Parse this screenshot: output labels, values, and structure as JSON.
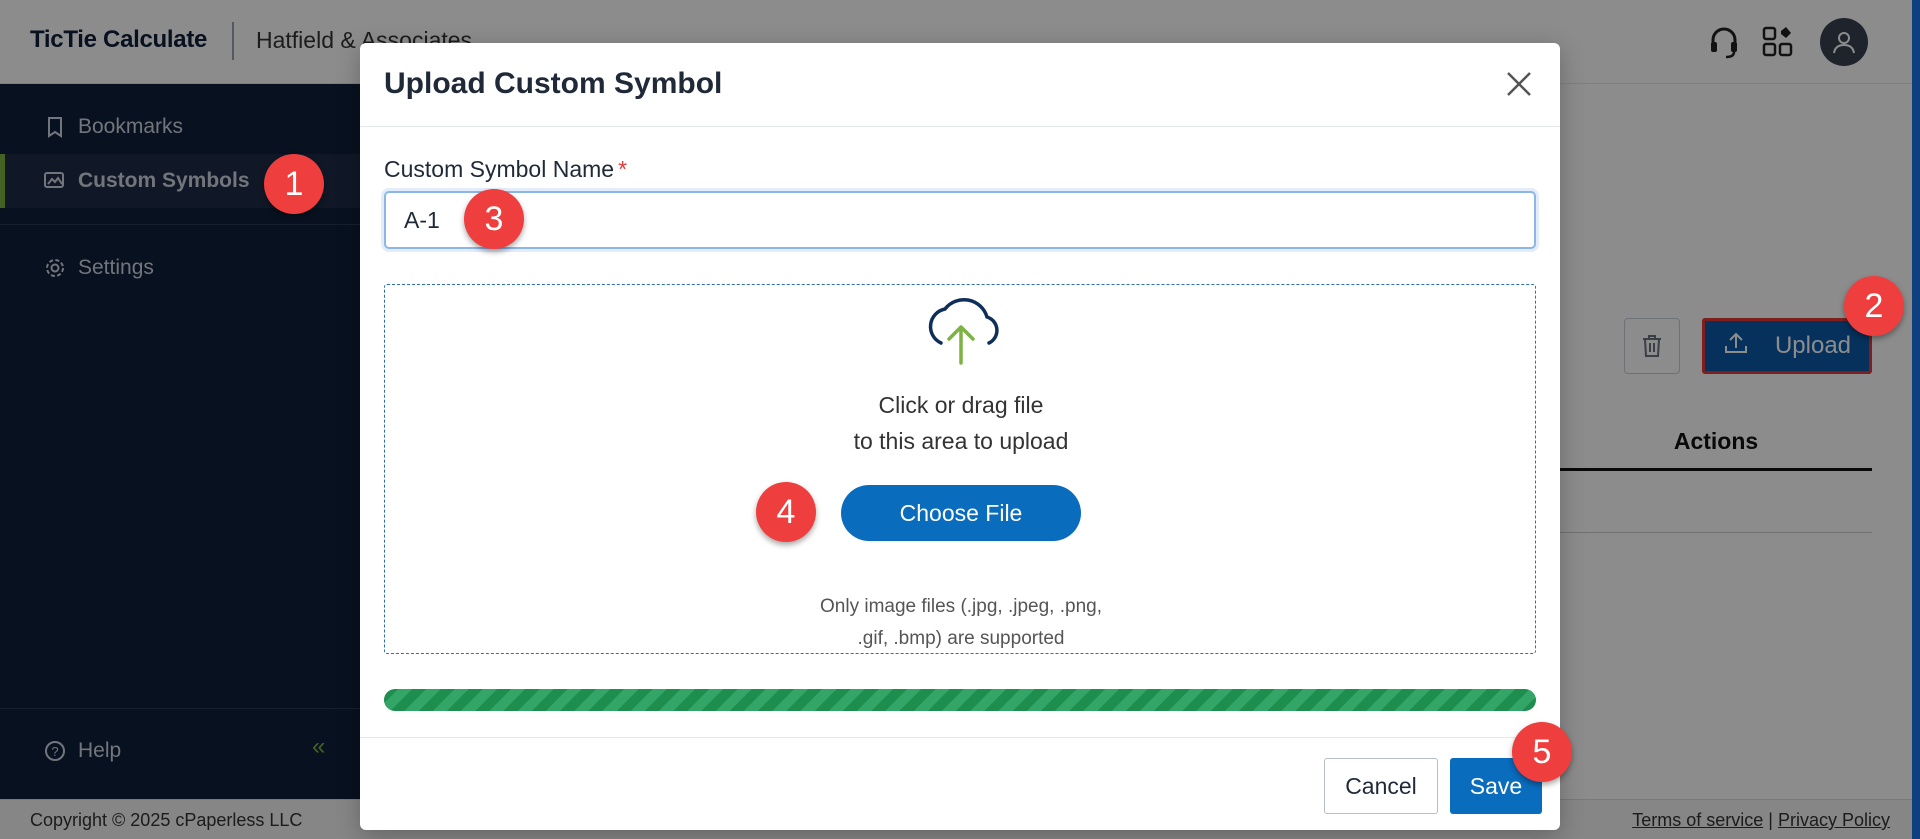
{
  "app": {
    "brand": "TicTie Calculate",
    "organization": "Hatfield & Associates"
  },
  "sidebar": {
    "items": [
      {
        "label": "Bookmarks",
        "icon": "bookmark-icon"
      },
      {
        "label": "Custom Symbols",
        "icon": "custom-symbols-icon",
        "active": true
      },
      {
        "label": "Settings",
        "icon": "gear-icon"
      }
    ],
    "help_label": "Help"
  },
  "page": {
    "upload_label": "Upload",
    "actions_header": "Actions"
  },
  "footer": {
    "copyright": "Copyright © 2025 cPaperless LLC",
    "terms": "Terms of service",
    "separator": "|",
    "privacy": "Privacy Policy"
  },
  "modal": {
    "title": "Upload Custom Symbol",
    "name_label": "Custom Symbol Name",
    "required_mark": "*",
    "name_value": "A-1",
    "dropzone_line1": "Click or drag file",
    "dropzone_line2": "to this area to upload",
    "choose_file_label": "Choose File",
    "hint_line1": "Only image files (.jpg, .jpeg, .png,",
    "hint_line2": ".gif, .bmp) are supported",
    "progress": 1.0,
    "cancel_label": "Cancel",
    "save_label": "Save"
  },
  "steps": [
    "1",
    "2",
    "3",
    "4",
    "5"
  ],
  "colors": {
    "sidebar_bg": "#0f1f3a",
    "accent_green": "#7cb342",
    "primary_blue": "#0a6cbd",
    "step_red": "#ef3e3e",
    "progress_green": "#1e8e4f"
  }
}
